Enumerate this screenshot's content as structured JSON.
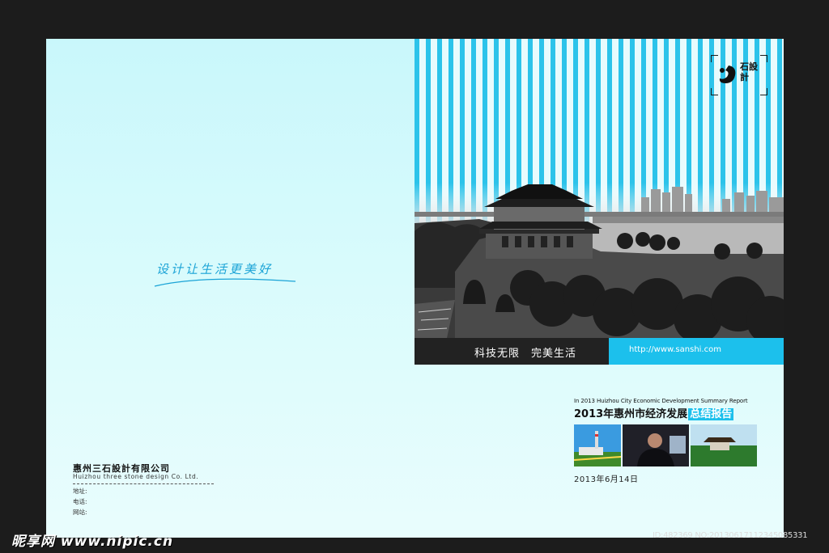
{
  "logo": {
    "text": "石設計"
  },
  "slogan": "设计让生活更美好",
  "bar": {
    "slogan": "科技无限　完美生活",
    "url": "http://www.sanshi.com"
  },
  "report": {
    "subtitle_en": "In 2013 Huizhou City Economic Development Summary Report",
    "title_main": "2013年惠州市经济发展",
    "title_highlight": "总结报告",
    "date": "2013年6月14日"
  },
  "company": {
    "name": "惠州三石設計有限公司",
    "name_en": "Huizhou three stone design Co. Ltd.",
    "address_label": "地址:",
    "phone_label": "电话:",
    "website_label": "网站:"
  },
  "watermark": {
    "left": "昵享网 www.nipic.cn",
    "right": "ID:482369 NO:20130617112345085331"
  },
  "colors": {
    "accent": "#1cc0ec",
    "dark_bar": "#222222",
    "background": "#1c1c1c"
  }
}
